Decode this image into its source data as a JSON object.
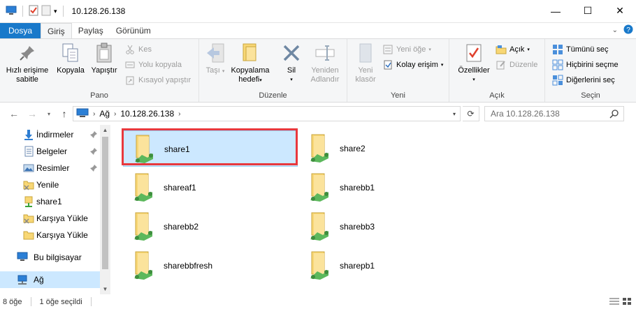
{
  "window": {
    "title": "10.128.26.138",
    "minimize": "—",
    "maximize": "☐",
    "close": "✕"
  },
  "tabs": {
    "file": "Dosya",
    "home": "Giriş",
    "share": "Paylaş",
    "view": "Görünüm"
  },
  "ribbon": {
    "pano": {
      "label": "Pano",
      "pin": "Hızlı erişime sabitle",
      "pin_l1": "Hızlı erişime",
      "pin_l2": "sabitle",
      "copy": "Kopyala",
      "paste": "Yapıştır",
      "cut": "Kes",
      "copy_path": "Yolu kopyala",
      "paste_shortcut": "Kısayol yapıştır"
    },
    "duzenle": {
      "label": "Düzenle",
      "move_to": "Taşı",
      "copy_to_l1": "Kopyalama",
      "copy_to_l2": "hedefi",
      "delete": "Sil",
      "rename_l1": "Yeniden",
      "rename_l2": "Adlandır"
    },
    "yeni": {
      "label": "Yeni",
      "new_folder_l1": "Yeni",
      "new_folder_l2": "klasör",
      "new_item": "Yeni öğe",
      "easy_access": "Kolay erişim"
    },
    "ac": {
      "label": "Açık",
      "properties": "Özellikler",
      "open": "Açık",
      "edit": "Düzenle"
    },
    "sec": {
      "label": "Seçin",
      "select_all": "Tümünü seç",
      "select_none": "Hiçbirini seçme",
      "invert": "Diğerlerini seç"
    }
  },
  "address": {
    "crumb_network": "Ağ",
    "crumb_host": "10.128.26.138",
    "search_placeholder": "Ara 10.128.26.138"
  },
  "nav": {
    "items": [
      {
        "label": "İndirmeler",
        "icon": "download-icon",
        "pinned": true
      },
      {
        "label": "Belgeler",
        "icon": "documents-icon",
        "pinned": true
      },
      {
        "label": "Resimler",
        "icon": "pictures-icon",
        "pinned": true
      },
      {
        "label": "Yenile",
        "icon": "folder-x-icon",
        "pinned": false
      },
      {
        "label": "share1",
        "icon": "network-drive-icon",
        "pinned": false
      },
      {
        "label": "Karşıya Yükle",
        "icon": "folder-x-icon",
        "pinned": false
      },
      {
        "label": "Karşıya Yükle",
        "icon": "folder-icon",
        "pinned": false
      },
      {
        "label": "Bu bilgisayar",
        "icon": "computer-icon",
        "pinned": false
      },
      {
        "label": "Ağ",
        "icon": "network-icon",
        "pinned": false
      }
    ]
  },
  "shares": [
    {
      "name": "share1",
      "selected": true
    },
    {
      "name": "share2",
      "selected": false
    },
    {
      "name": "shareaf1",
      "selected": false
    },
    {
      "name": "sharebb1",
      "selected": false
    },
    {
      "name": "sharebb2",
      "selected": false
    },
    {
      "name": "sharebb3",
      "selected": false
    },
    {
      "name": "sharebbfresh",
      "selected": false
    },
    {
      "name": "sharepb1",
      "selected": false
    }
  ],
  "status": {
    "count": "8 öğe",
    "selected": "1 öğe seçildi"
  },
  "colors": {
    "accent": "#1979ca",
    "selection": "#cce8ff",
    "highlight_box": "#e8383d",
    "folder": "#f8d775"
  }
}
